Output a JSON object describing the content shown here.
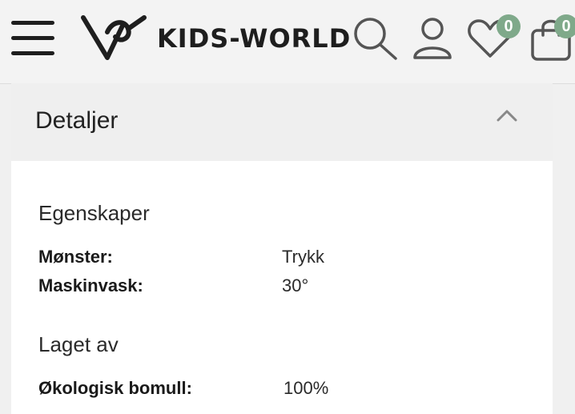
{
  "header": {
    "brand": "KIDS-WORLD",
    "wishlist_count": "0",
    "cart_count": "0",
    "accent_color": "#7fa98a"
  },
  "accordion": {
    "title": "Detaljer",
    "expanded": true,
    "sections": [
      {
        "title": "Egenskaper",
        "rows": [
          {
            "label": "Mønster:",
            "value": "Trykk"
          },
          {
            "label": "Maskinvask:",
            "value": "30°"
          }
        ]
      },
      {
        "title": "Laget av",
        "rows": [
          {
            "label": "Økologisk bomull:",
            "value": "100%"
          }
        ]
      }
    ]
  },
  "icons": [
    "menu-icon",
    "logo-icon",
    "search-icon",
    "user-icon",
    "heart-icon",
    "cart-icon",
    "chevron-up-icon"
  ]
}
